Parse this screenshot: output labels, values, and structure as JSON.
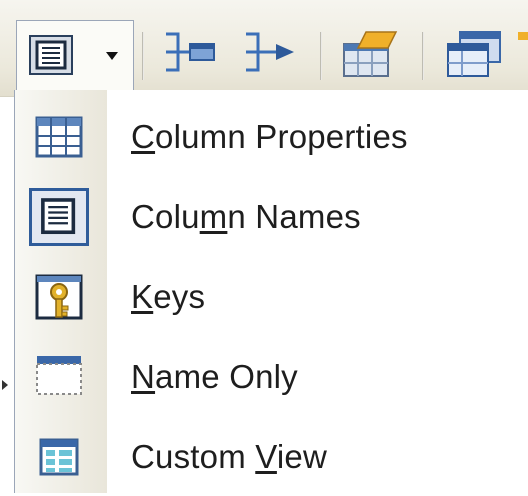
{
  "toolbar": {
    "buttons": [
      {
        "name": "table-view-dropdown",
        "icon": "column-names-icon"
      },
      {
        "name": "arrange-selection-button",
        "icon": "arrange-selection-icon"
      },
      {
        "name": "arrange-tables-button",
        "icon": "arrange-tables-icon"
      },
      {
        "name": "autosize-tables-button",
        "icon": "autosize-tables-icon"
      },
      {
        "name": "new-table-button",
        "icon": "new-table-icon"
      }
    ]
  },
  "menu": {
    "items": [
      {
        "pre": "",
        "key": "C",
        "post": "olumn Properties",
        "icon": "column-properties-icon",
        "checked": false
      },
      {
        "pre": "Colu",
        "key": "m",
        "post": "n Names",
        "icon": "column-names-icon",
        "checked": true
      },
      {
        "pre": "",
        "key": "K",
        "post": "eys",
        "icon": "keys-icon",
        "checked": false
      },
      {
        "pre": "",
        "key": "N",
        "post": "ame Only",
        "icon": "name-only-icon",
        "checked": false
      },
      {
        "pre": "Custom ",
        "key": "V",
        "post": "iew",
        "icon": "custom-view-icon",
        "checked": false
      }
    ]
  },
  "colors": {
    "checked_border": "#2f5c9a",
    "checked_fill": "#e3e8f1",
    "toolbar_bg": "#ece9dc",
    "text": "#1e1e1e"
  }
}
